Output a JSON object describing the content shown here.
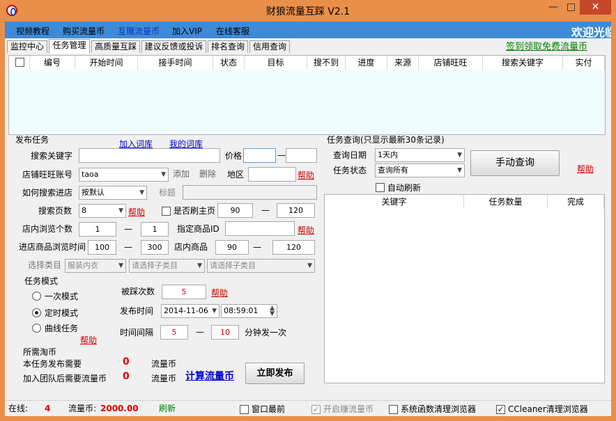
{
  "window": {
    "title": "财狼流量互踩  V2.1",
    "min": "—",
    "max": "□",
    "close": "✕"
  },
  "menu": {
    "items": [
      "视频教程",
      "购买流量币",
      "互赠流量币",
      "加入VIP",
      "在线客服"
    ],
    "welcome": "欢迎光临"
  },
  "tabs": [
    "监控中心",
    "任务管理",
    "高质量互踩",
    "建议反馈或投诉",
    "排名查询",
    "信用查询"
  ],
  "free_coin_link": "签到领取免费流量币",
  "table": {
    "columns": [
      "编号",
      "开始时间",
      "接手时间",
      "状态",
      "目标",
      "搜不到",
      "进度",
      "来源",
      "店铺旺旺",
      "搜索关键字",
      "实付"
    ]
  },
  "publish": {
    "section_title": "发布任务",
    "add_lexicon": "加入词库",
    "my_lexicon": "我的词库",
    "keyword_label": "搜索关键字",
    "keyword_value": "",
    "price_label": "价格",
    "price_min": "",
    "price_max": "",
    "shop_label": "店铺旺旺账号",
    "shop_value": "taoa",
    "add_btn": "添加",
    "del_btn": "删除",
    "region_label": "地区",
    "region_value": "",
    "help": "帮助",
    "search_method_label": "如何搜索进店",
    "search_method_value": "按默认",
    "title_label": "标题",
    "pages_label": "搜索页数",
    "pages_value": "8",
    "brush_home_label": "是否刷主页",
    "brush_home_min": "90",
    "brush_home_max": "120",
    "browse_count_label": "店内浏览个数",
    "browse_count_min": "1",
    "browse_count_max": "1",
    "product_id_label": "指定商品ID",
    "product_id_value": "",
    "browse_time_label": "进店商品浏览时间",
    "browse_time_min": "100",
    "browse_time_max": "300",
    "shop_goods_label": "店内商品",
    "shop_goods_min": "90",
    "shop_goods_max": "120",
    "category_label": "选择类目",
    "category_value": "服装内衣",
    "sub_category_1": "请选择子类目",
    "sub_category_2": "请选择子类目",
    "mode_title": "任务模式",
    "mode_once": "一次模式",
    "mode_timed": "定时模式",
    "mode_curve": "曲线任务",
    "stepped_times_label": "被踩次数",
    "stepped_times_value": "5",
    "publish_time_label": "发布时间",
    "publish_date": "2014-11-06",
    "publish_time": "08:59:01",
    "interval_label": "时间间隔",
    "interval_min": "5",
    "interval_max": "10",
    "interval_unit": "分钟发一次",
    "coin_needed_title": "所需淘币",
    "cost_label": "本任务发布需要",
    "cost_value": "0",
    "cost_unit": "流量币",
    "team_cost_label": "加入团队后需要流量币",
    "team_cost_value": "0",
    "team_cost_unit": "流量币",
    "calc_link": "计算流量币",
    "publish_btn": "立即发布",
    "dash": "—"
  },
  "query": {
    "section_title": "任务查询(只显示最新30条记录)",
    "date_label": "查询日期",
    "date_value": "1天内",
    "status_label": "任务状态",
    "status_value": "查询所有",
    "manual_btn": "手动查询",
    "help": "帮助",
    "auto_refresh": "自动刷新",
    "columns": [
      "关键字",
      "任务数量",
      "完成"
    ]
  },
  "statusbar": {
    "online_label": "在线:",
    "online_value": "4",
    "coin_label": "流量币:",
    "coin_value": "2000.00",
    "refresh": "刷新",
    "top_window": "窗口最前",
    "earn_browser": "开启赚流量币",
    "sys_clean": "系统函数清理浏览器",
    "ccleaner": "CCleaner清理浏览器"
  },
  "colors": {
    "title_bar": "#e98f4a",
    "menu_bar": "#3e8ad6",
    "table_bg": "#f0fdff",
    "accent_red": "#cc0000",
    "link_blue": "#0000cc",
    "link_green": "#008000"
  }
}
